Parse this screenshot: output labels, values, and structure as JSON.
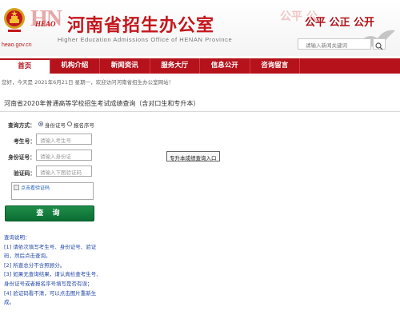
{
  "header": {
    "domain": "heao.gov.cn",
    "logo_text": "HEAO",
    "logo_big": "HN",
    "title": "河南省招生办公室",
    "subtitle": "Higher Education Admissions Office of HENAN Province",
    "slogan": "公平 公正 公开",
    "slogan_ghost": "公平 公",
    "search_placeholder": "请输入新闻关键词"
  },
  "nav": {
    "items": [
      {
        "label": "首页"
      },
      {
        "label": "机构介绍"
      },
      {
        "label": "新闻资讯"
      },
      {
        "label": "服务大厅"
      },
      {
        "label": "信息公开"
      },
      {
        "label": "咨询留言"
      }
    ]
  },
  "info_bar": {
    "text": "您好，今天是 2021年6月21日 星期一，欢迎访问河南省招生办公室网站！"
  },
  "panel": {
    "title": "河南省2020年普通高等学校招生考试成绩查询（含对口生和专升本）"
  },
  "form": {
    "query_method_label": "查询方式：",
    "option_id": "身份证号",
    "option_reg": "报名序号",
    "selected": "身份证号",
    "exam_no_label": "考生号：",
    "exam_no_placeholder": "请输入考生号",
    "id_label": "身份证号：",
    "id_placeholder": "请输入身份证",
    "captcha_label": "验证码：",
    "captcha_placeholder": "请输入下图验证码",
    "captcha_image_text": "点击看验证码",
    "submit_label": "查 询",
    "tooltip": "专升本成绩查询入口"
  },
  "help": {
    "title": "查询说明：",
    "lines": [
      "[1] 请依次填写考生号、身份证号、验证",
      "码，然后点击查询。",
      "[2] 所查总分不含照顾分。",
      "[3] 如果无查询结果，请认真检查考生号、",
      "身份证号或者报名序号填写是否有误；",
      "[4] 验证码看不清，可以点击图片重新生",
      "成。"
    ]
  }
}
